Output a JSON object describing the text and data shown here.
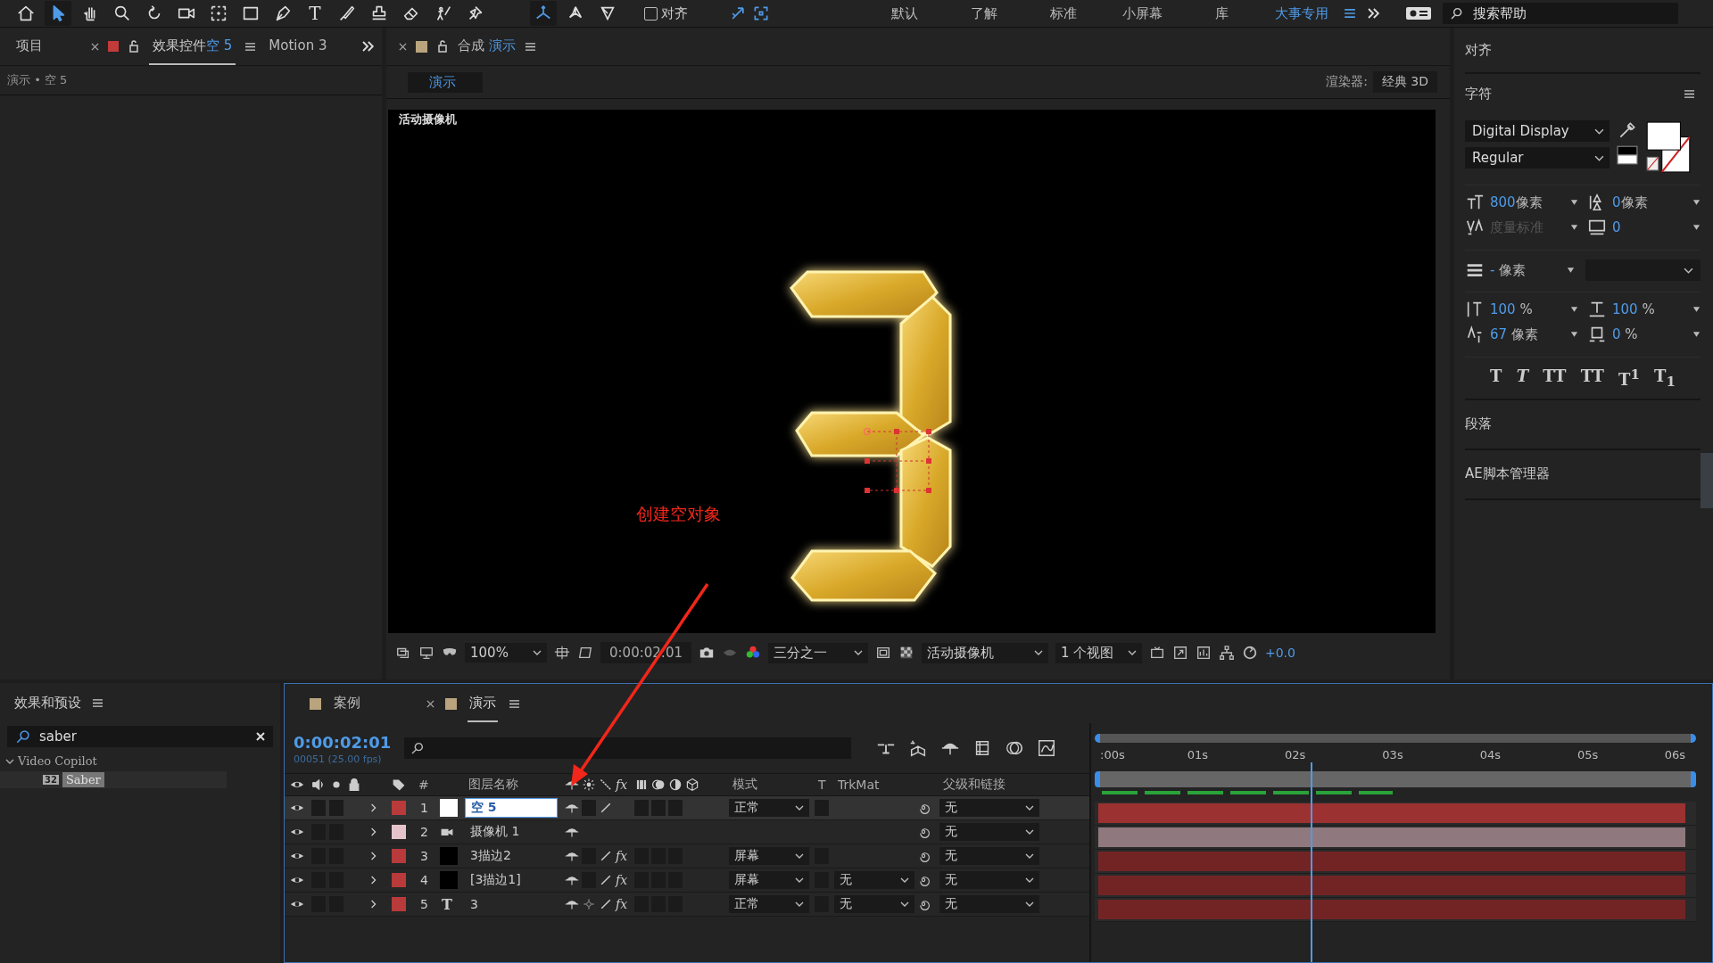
{
  "toolbar": {
    "tools": [
      {
        "kind": "home",
        "selected": false
      },
      {
        "kind": "select",
        "selected": true
      },
      {
        "kind": "hand",
        "selected": false
      },
      {
        "kind": "zoom",
        "selected": false
      },
      {
        "kind": "rotate",
        "selected": false
      },
      {
        "kind": "camera",
        "selected": false
      },
      {
        "kind": "pan-behind",
        "selected": false
      },
      {
        "kind": "rectangle",
        "selected": false
      },
      {
        "kind": "pen",
        "selected": false
      },
      {
        "kind": "text",
        "glyph": "T",
        "selected": false
      },
      {
        "kind": "brush",
        "selected": false
      },
      {
        "kind": "stamp",
        "selected": false
      },
      {
        "kind": "eraser",
        "selected": false
      },
      {
        "kind": "roto",
        "selected": false
      },
      {
        "kind": "pin",
        "selected": false
      }
    ],
    "axis_modes": [
      {
        "kind": "local",
        "selected": true
      },
      {
        "kind": "world",
        "selected": false
      },
      {
        "kind": "view",
        "selected": false
      }
    ],
    "snapping": {
      "label": "对齐",
      "checked": false
    },
    "workspaces": [
      {
        "label": "默认",
        "selected": false
      },
      {
        "label": "了解",
        "selected": false
      },
      {
        "label": "标准",
        "selected": false
      },
      {
        "label": "小屏幕",
        "selected": false
      },
      {
        "label": "库",
        "selected": false
      },
      {
        "label": "大事专用",
        "selected": true
      }
    ],
    "search_help": {
      "placeholder": "搜索帮助"
    }
  },
  "left_panel": {
    "tabs": [
      {
        "label": "项目",
        "selected": false
      },
      {
        "label": "效果控件",
        "layer": "空 5",
        "selected": true
      },
      {
        "label": "Motion 3",
        "selected": false
      }
    ],
    "breadcrumb": "演示 • 空 5"
  },
  "comp_panel": {
    "tab_prefix": "合成",
    "tab_name": "演示",
    "crumb": "演示",
    "renderer_label": "渲染器:",
    "renderer": "经典 3D",
    "view_label": "活动摄像机",
    "annotation": "创建空对象",
    "footer": {
      "zoom": "100%",
      "time": "0:00:02:01",
      "resolution": "三分之一",
      "camera": "活动摄像机",
      "views": "1 个视图",
      "exposure": "+0.0"
    }
  },
  "right_panel": {
    "align_title": "对齐",
    "character": {
      "title": "字符",
      "font": "Digital Display",
      "style": "Regular",
      "metrics": [
        {
          "kind": "size",
          "value": "800",
          "unit": "像素",
          "disabled": false
        },
        {
          "kind": "leading",
          "value": "0",
          "unit": "像素",
          "disabled": false
        },
        {
          "kind": "kerning",
          "value": "度量标准",
          "disabled": true
        },
        {
          "kind": "tracking",
          "value": "0",
          "disabled": false
        }
      ],
      "stroke": {
        "value": "-",
        "unit": "像素"
      },
      "scales": [
        {
          "kind": "vscale",
          "value": "100",
          "unit": "%"
        },
        {
          "kind": "hscale",
          "value": "100",
          "unit": "%"
        },
        {
          "kind": "baseline",
          "value": "67",
          "unit": "像素"
        },
        {
          "kind": "tsume",
          "value": "0",
          "unit": "%"
        }
      ],
      "styles": [
        {
          "label": "T",
          "kind": "bold"
        },
        {
          "label": "T",
          "kind": "italic"
        },
        {
          "label": "TT",
          "kind": "caps"
        },
        {
          "label": "TT",
          "kind": "smallcaps"
        },
        {
          "label": "T$^{1}$",
          "kind": "super"
        },
        {
          "label": "T$_{1}$",
          "kind": "sub"
        }
      ]
    },
    "paragraph_title": "段落",
    "scripts_title": "AE脚本管理器"
  },
  "effects_panel": {
    "title": "效果和预设",
    "search": "saber",
    "tree": [
      {
        "label": "Video Copilot",
        "expanded": true,
        "selected": false,
        "children": [
          {
            "label": "Saber",
            "badge": "32",
            "selected": true
          }
        ]
      }
    ]
  },
  "timeline": {
    "tabs": [
      {
        "label": "案例",
        "selected": false,
        "closable": false
      },
      {
        "label": "演示",
        "selected": true,
        "closable": true
      }
    ],
    "timecode": "0:00:02:01",
    "frame_info": "00051 (25.00 fps)",
    "headers": {
      "number": "#",
      "name": "图层名称",
      "fx": "fx",
      "mode": "模式",
      "t": "T",
      "trkmat": "TrkMat",
      "parent": "父级和链接"
    },
    "layers": [
      {
        "number": "1",
        "color": "#b83a3a",
        "kind": "null",
        "name": "空 5",
        "selected": true,
        "collapse": false,
        "quality": true,
        "mode": "正常",
        "parent": "无"
      },
      {
        "number": "2",
        "color": "#e6c3cc",
        "kind": "camera",
        "name": "摄像机 1",
        "selected": false,
        "collapse": false,
        "quality": false,
        "parent": "无"
      },
      {
        "number": "3",
        "color": "#b83a3a",
        "kind": "solid",
        "name": "3描边2",
        "selected": false,
        "collapse": false,
        "quality": true,
        "effect": "fx",
        "mode": "屏幕",
        "parent": "无"
      },
      {
        "number": "4",
        "color": "#b83a3a",
        "kind": "solid",
        "name": "[3描边1]",
        "selected": false,
        "collapse": false,
        "quality": true,
        "effect": "fx",
        "mode": "屏幕",
        "trkmat": "无",
        "parent": "无"
      },
      {
        "number": "5",
        "color": "#b83a3a",
        "kind": "text",
        "glyph": "T",
        "name": "3",
        "selected": false,
        "collapse": true,
        "quality": true,
        "effect": "fx",
        "mode": "正常",
        "trkmat": "无",
        "parent": "无"
      }
    ],
    "ruler": [
      ":00s",
      "01s",
      "02s",
      "03s",
      "04s",
      "05s",
      "06s"
    ],
    "playhead": {
      "level": 0.342
    }
  }
}
